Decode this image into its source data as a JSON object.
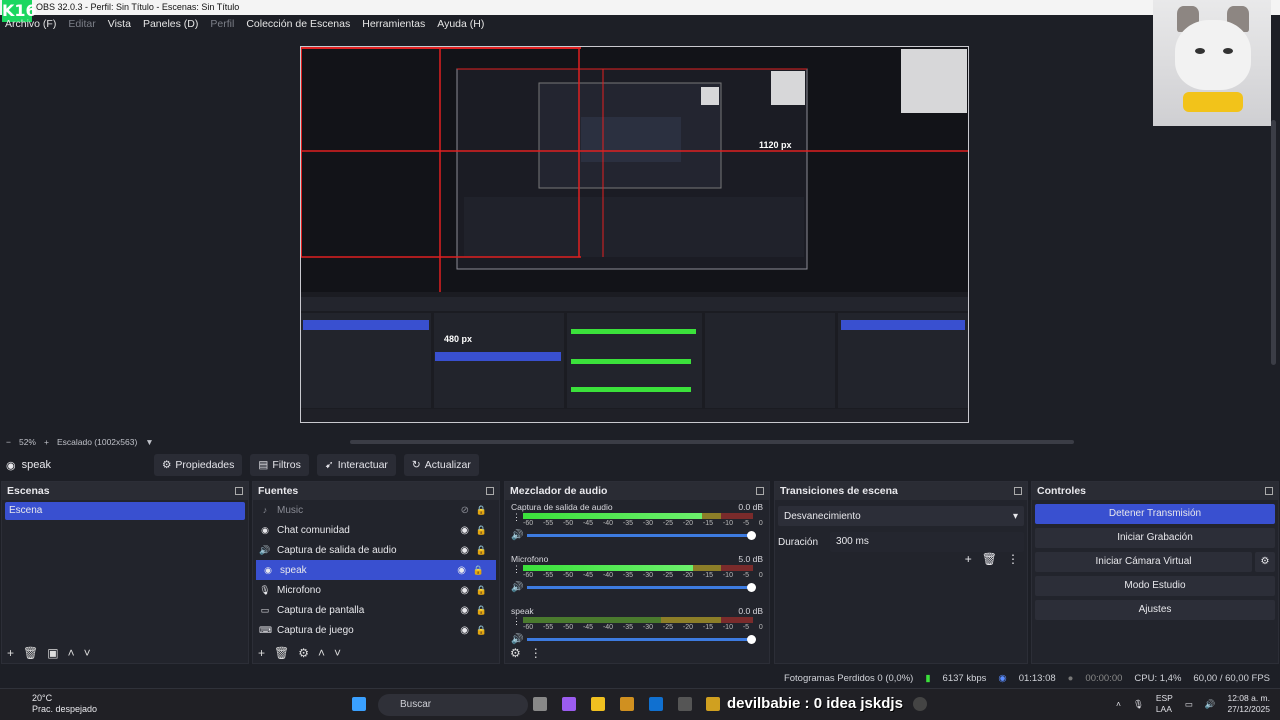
{
  "window": {
    "title": "OBS 32.0.3 - Perfil: Sin Título - Escenas: Sin Título",
    "logo_text": "K16"
  },
  "menu": [
    "Archivo (F)",
    "Editar",
    "Vista",
    "Paneles (D)",
    "Perfil",
    "Colección de Escenas",
    "Herramientas",
    "Ayuda (H)"
  ],
  "preview": {
    "zoom": "52%",
    "scaling": "Escalado (1002x563)",
    "label_1120": "1120 px",
    "label_480": "480 px"
  },
  "source_toolbar": {
    "selected_source": "speak",
    "buttons": [
      "Propiedades",
      "Filtros",
      "Interactuar",
      "Actualizar"
    ]
  },
  "scenes": {
    "title": "Escenas",
    "items": [
      "Escena"
    ]
  },
  "sources": {
    "title": "Fuentes",
    "items": [
      {
        "name": "Music",
        "icon": "music-icon",
        "state": "muted"
      },
      {
        "name": "Chat comunidad",
        "icon": "globe-icon",
        "state": "normal"
      },
      {
        "name": "Captura de salida de audio",
        "icon": "speaker-icon",
        "state": "normal"
      },
      {
        "name": "speak",
        "icon": "globe-icon",
        "state": "selected"
      },
      {
        "name": "Microfono",
        "icon": "mic-icon",
        "state": "normal"
      },
      {
        "name": "Captura de pantalla",
        "icon": "monitor-icon",
        "state": "normal"
      },
      {
        "name": "Captura de juego",
        "icon": "gamepad-icon",
        "state": "normal"
      }
    ]
  },
  "mixer": {
    "title": "Mezclador de audio",
    "ticks": [
      "-60",
      "-55",
      "-50",
      "-45",
      "-40",
      "-35",
      "-30",
      "-25",
      "-20",
      "-15",
      "-10",
      "-5",
      "0"
    ],
    "channels": [
      {
        "name": "Captura de salida de audio",
        "db": "0.0 dB",
        "level": 0.78
      },
      {
        "name": "Microfono",
        "db": "5.0 dB",
        "level": 0.74
      },
      {
        "name": "speak",
        "db": "0.0 dB",
        "level": 0.0
      }
    ]
  },
  "transitions": {
    "title": "Transiciones de escena",
    "selected": "Desvanecimiento",
    "duration_label": "Duración",
    "duration_value": "300 ms"
  },
  "controls": {
    "title": "Controles",
    "buttons": [
      "Detener Transmisión",
      "Iniciar Grabación",
      "Iniciar Cámara Virtual",
      "Modo Estudio",
      "Ajustes"
    ]
  },
  "status": {
    "dropped": "Fotogramas Perdidos 0 (0,0%)",
    "bitrate": "6137 kbps",
    "stream_time": "01:13:08",
    "rec_time": "00:00:00",
    "cpu": "CPU: 1,4%",
    "fps": "60,00 / 60,00 FPS"
  },
  "taskbar": {
    "temp": "20°C",
    "weather": "Prac. despejado",
    "search": "Buscar",
    "overlay": "devilbabie : 0 idea jskdjs",
    "lang": "ESP",
    "lang2": "LAA",
    "time": "12:08 a. m.",
    "date": "27/12/2025"
  }
}
